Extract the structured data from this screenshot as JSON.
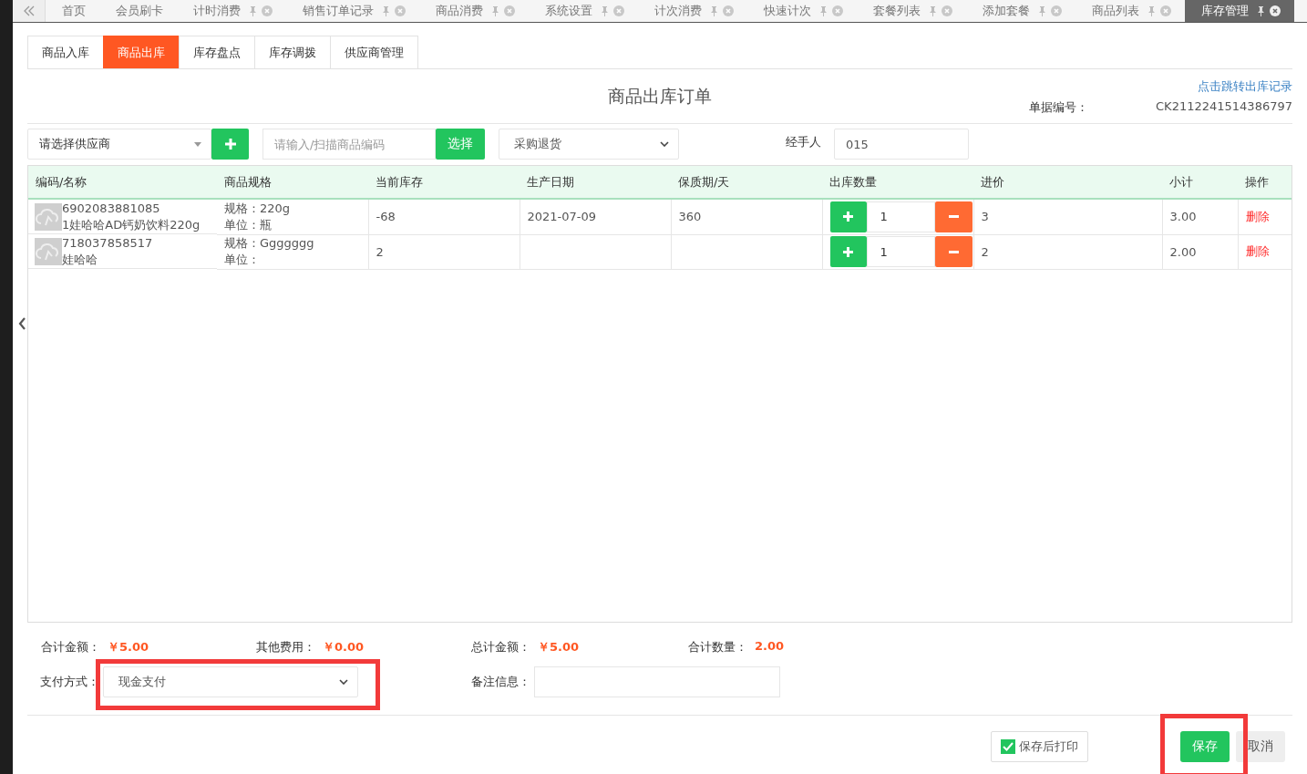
{
  "top_tabs": [
    {
      "label": "首页",
      "closable": false,
      "selected": false
    },
    {
      "label": "会员刷卡",
      "closable": false,
      "selected": false
    },
    {
      "label": "计时消费",
      "closable": true,
      "selected": false
    },
    {
      "label": "销售订单记录",
      "closable": true,
      "selected": false
    },
    {
      "label": "商品消费",
      "closable": true,
      "selected": false
    },
    {
      "label": "系统设置",
      "closable": true,
      "selected": false
    },
    {
      "label": "计次消费",
      "closable": true,
      "selected": false
    },
    {
      "label": "快速计次",
      "closable": true,
      "selected": false
    },
    {
      "label": "套餐列表",
      "closable": true,
      "selected": false
    },
    {
      "label": "添加套餐",
      "closable": true,
      "selected": false
    },
    {
      "label": "商品列表",
      "closable": true,
      "selected": false
    },
    {
      "label": "库存管理",
      "closable": true,
      "selected": true
    }
  ],
  "sub_tabs": [
    {
      "label": "商品入库",
      "selected": false
    },
    {
      "label": "商品出库",
      "selected": true
    },
    {
      "label": "库存盘点",
      "selected": false
    },
    {
      "label": "库存调拨",
      "selected": false
    },
    {
      "label": "供应商管理",
      "selected": false
    }
  ],
  "title": "商品出库订单",
  "record_link": "点击跳转出库记录",
  "doc_no_label": "单据编号：",
  "doc_no": "CK2112241514386797",
  "toolbar": {
    "supplier_select": "请选择供应商",
    "code_placeholder": "请输入/扫描商品编码",
    "select_button": "选择",
    "type_select": "采购退货",
    "handler_label": "经手人",
    "handler_value": "015"
  },
  "table": {
    "columns": [
      "编码/名称",
      "商品规格",
      "当前库存",
      "生产日期",
      "保质期/天",
      "出库数量",
      "进价",
      "小计",
      "操作"
    ],
    "rows": [
      {
        "code": "6902083881085",
        "name": "1娃哈哈AD钙奶饮料220g",
        "spec": "规格：220g",
        "unit": "单位：瓶",
        "stock": "-68",
        "date": "2021-07-09",
        "shelf_life": "360",
        "qty": "1",
        "price": "3",
        "subtotal": "3.00",
        "action": "删除"
      },
      {
        "code": "718037858517",
        "name": "娃哈哈",
        "spec": "规格：Ggggggg",
        "unit": "单位：",
        "stock": "2",
        "date": "",
        "shelf_life": "",
        "qty": "1",
        "price": "2",
        "subtotal": "2.00",
        "action": "删除"
      }
    ]
  },
  "summary": [
    {
      "label": "合计金额：",
      "value": "￥5.00"
    },
    {
      "label": "其他费用：",
      "value": "￥0.00"
    },
    {
      "label": "总计金额：",
      "value": "￥5.00"
    },
    {
      "label": "合计数量：",
      "value": "2.00"
    }
  ],
  "payment": {
    "label": "支付方式：",
    "value": "现金支付"
  },
  "remark": {
    "label": "备注信息："
  },
  "print_after_save": {
    "label": "保存后打印",
    "checked": true
  },
  "buttons": {
    "save": "保存",
    "cancel": "取消"
  }
}
